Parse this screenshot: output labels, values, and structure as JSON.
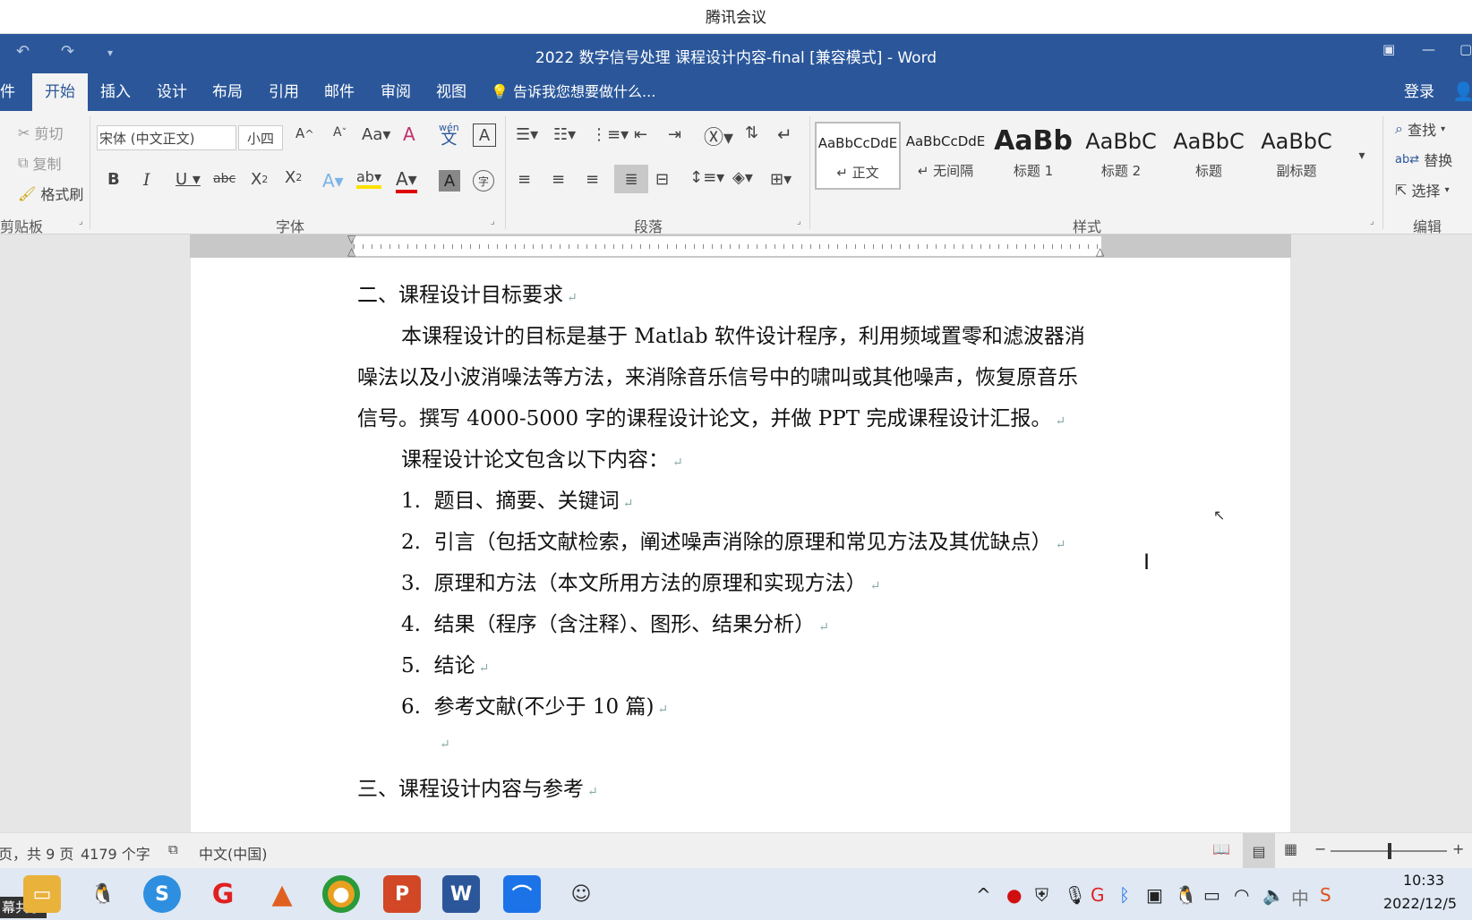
{
  "meeting": {
    "title": "腾讯会议"
  },
  "window": {
    "title": "2022 数字信号处理 课程设计内容-final [兼容模式] - Word"
  },
  "tabs": [
    "件",
    "开始",
    "插入",
    "设计",
    "布局",
    "引用",
    "邮件",
    "审阅",
    "视图"
  ],
  "tell_me": "告诉我您想要做什么...",
  "login": "登录",
  "clipboard": {
    "cut": "剪切",
    "copy": "复制",
    "format_painter": "格式刷",
    "label": "剪贴板"
  },
  "font": {
    "name": "宋体 (中文正文)",
    "size": "小四",
    "label": "字体",
    "aa": "Aa",
    "wen": "wén",
    "wen_char": "文",
    "a_char": "A",
    "zi": "字"
  },
  "paragraph": {
    "label": "段落"
  },
  "styles": {
    "label": "样式",
    "items": [
      {
        "preview": "AaBbCcDdE",
        "name": "↵ 正文"
      },
      {
        "preview": "AaBbCcDdE",
        "name": "↵ 无间隔"
      },
      {
        "preview": "AaBb",
        "name": "标题 1"
      },
      {
        "preview": "AaBbC",
        "name": "标题 2"
      },
      {
        "preview": "AaBbC",
        "name": "标题"
      },
      {
        "preview": "AaBbC",
        "name": "副标题"
      }
    ]
  },
  "editing": {
    "find": "查找",
    "replace": "替换",
    "select": "选择",
    "label": "编辑"
  },
  "document": {
    "heading2": "二、课程设计目标要求",
    "para1_l1": "本课程设计的目标是基于 Matlab 软件设计程序，利用频域置零和滤波器消",
    "para1_l2": "噪法以及小波消噪法等方法，来消除音乐信号中的啸叫或其他噪声，恢复原音乐",
    "para1_l3": "信号。撰写 4000-5000 字的课程设计论文，并做 PPT 完成课程设计汇报。",
    "para2": "课程设计论文包含以下内容：",
    "items": [
      {
        "num": "1.",
        "text": "题目、摘要、关键词"
      },
      {
        "num": "2.",
        "text": "引言（包括文献检索，阐述噪声消除的原理和常见方法及其优缺点）"
      },
      {
        "num": "3.",
        "text": "原理和方法（本文所用方法的原理和实现方法）"
      },
      {
        "num": "4.",
        "text": "结果（程序（含注释）、图形、结果分析）"
      },
      {
        "num": "5.",
        "text": "结论"
      },
      {
        "num": "6.",
        "text": "参考文献(不少于 10 篇)"
      }
    ],
    "heading3": "三、课程设计内容与参考"
  },
  "status": {
    "page": "页，共 9 页",
    "words": "4179 个字",
    "lang": "中文(中国)"
  },
  "taskbar": {
    "share": "幕共享",
    "time": "10:33",
    "date": "2022/12/5",
    "ime": "中"
  },
  "colors": {
    "word_blue": "#2b579a",
    "ribbon_bg": "#f3f3f3"
  }
}
